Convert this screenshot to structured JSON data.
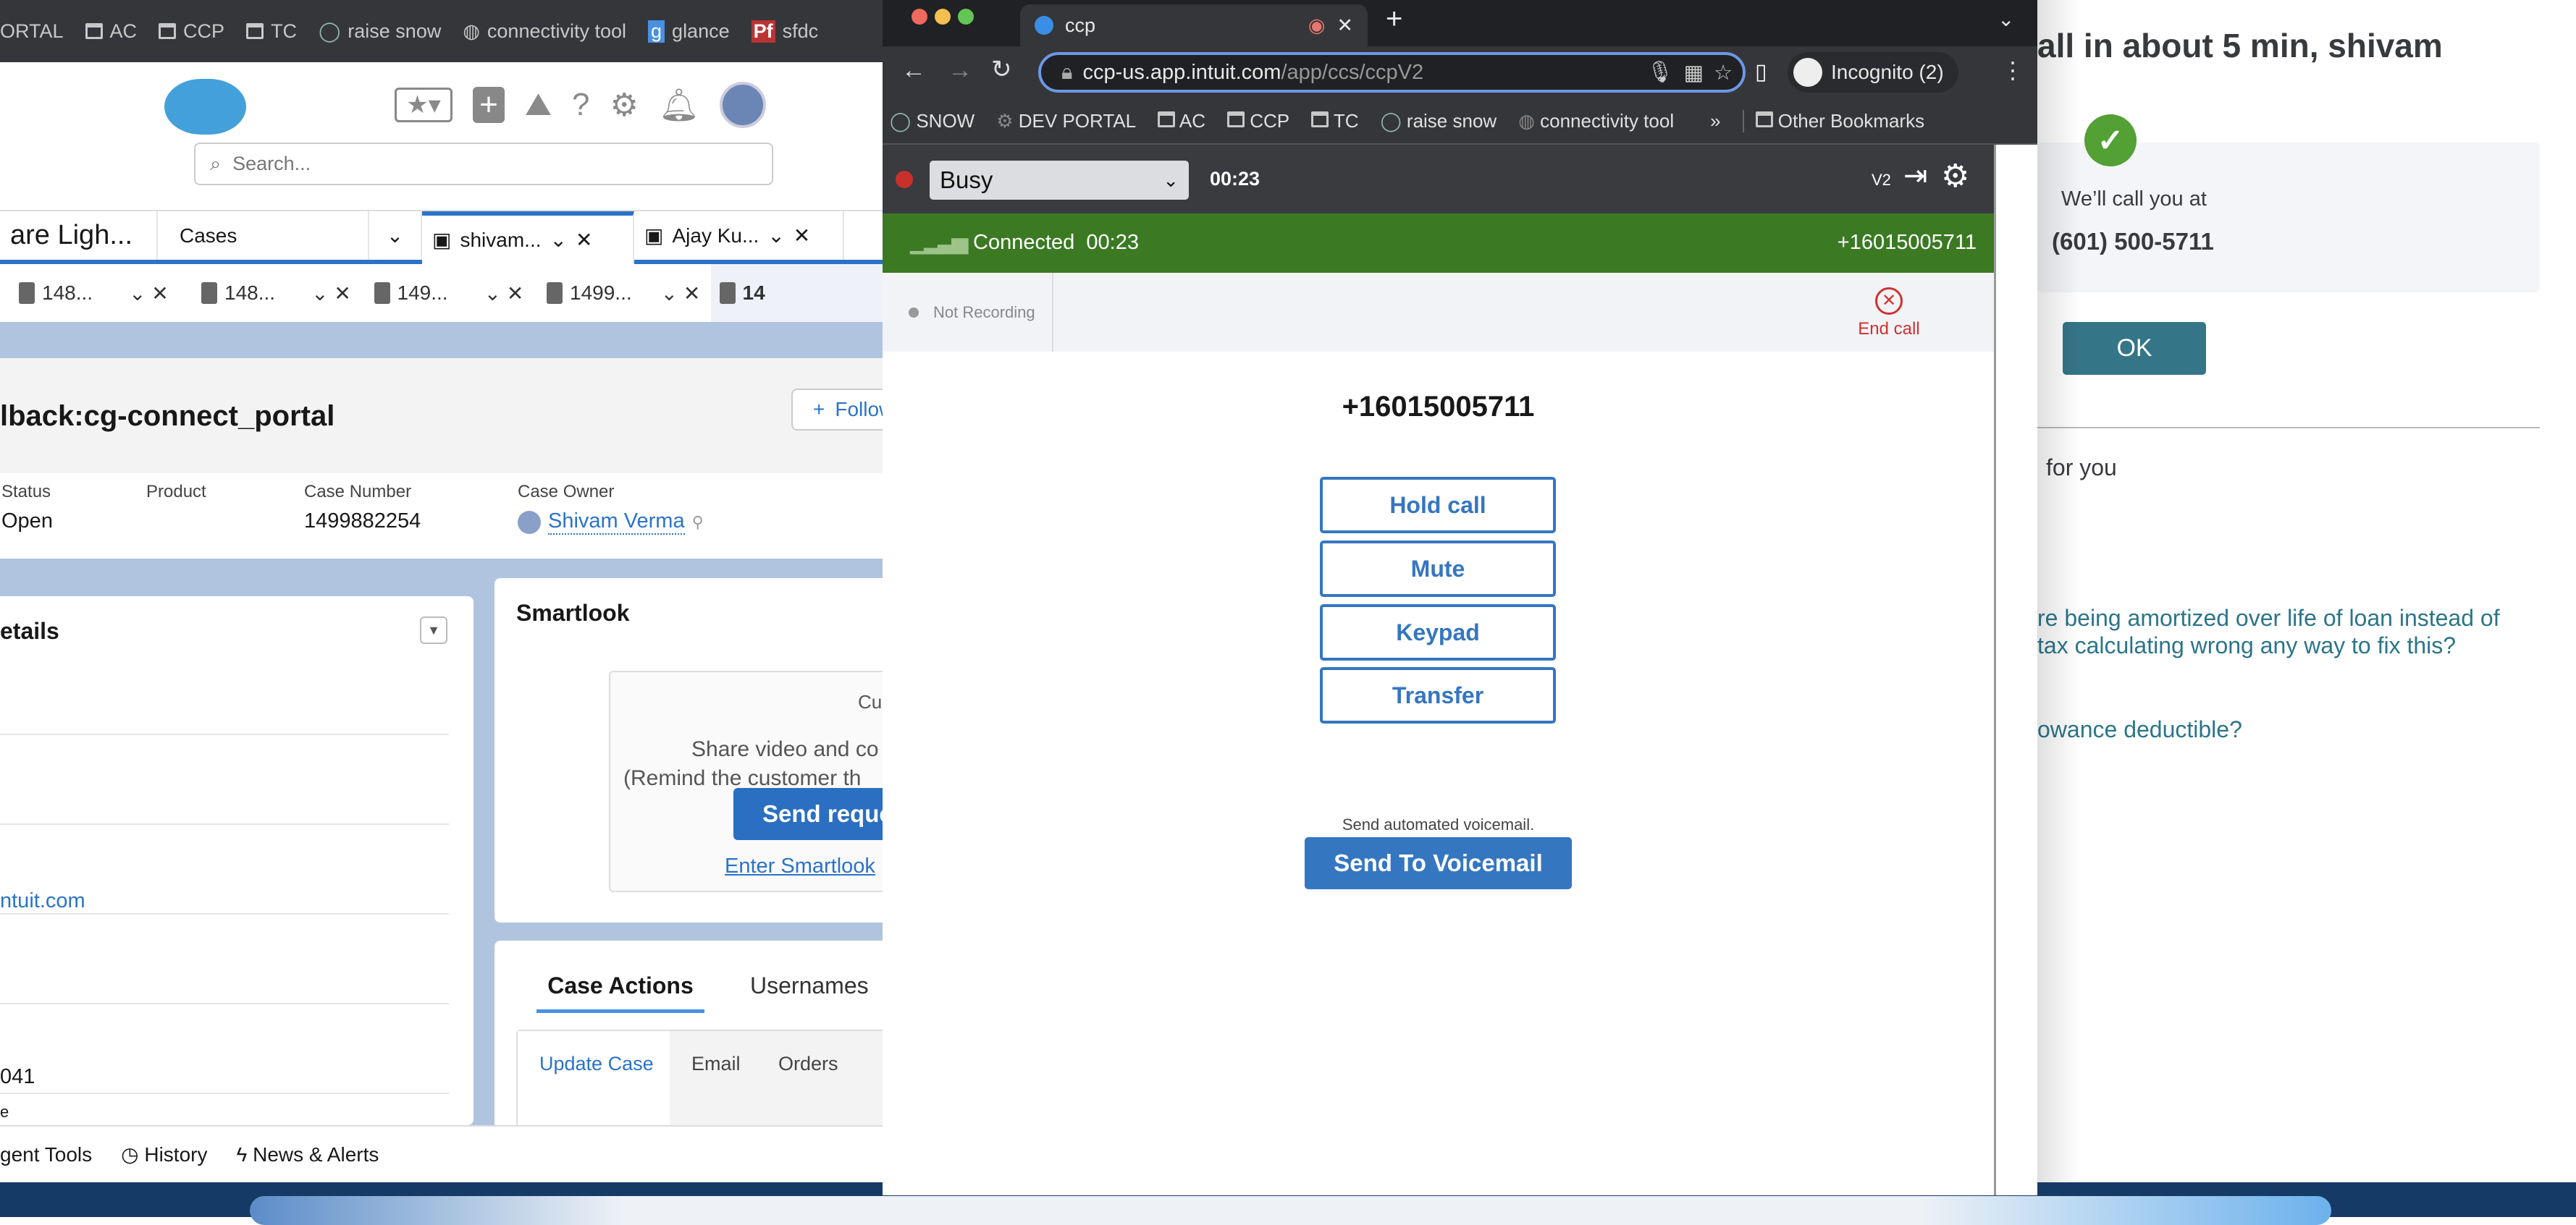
{
  "sf_bookmarks": [
    "ORTAL",
    "AC",
    "CCP",
    "TC",
    "raise snow",
    "connectivity tool",
    "glance",
    "sfdc"
  ],
  "sf_header": {
    "search_placeholder": "Search..."
  },
  "sf_tabs": [
    {
      "label": "are Ligh..."
    },
    {
      "label": "Cases"
    },
    {
      "label": "shivam..."
    },
    {
      "label": "Ajay Ku..."
    }
  ],
  "sf_subtabs": [
    "148...",
    "148...",
    "149...",
    "1499...",
    "14"
  ],
  "case": {
    "title": "lback:cg-connect_portal",
    "follow_label": "Follow",
    "fields": [
      {
        "label": "Status",
        "value": "Open"
      },
      {
        "label": "Product",
        "value": ""
      },
      {
        "label": "Case Number",
        "value": "1499882254"
      },
      {
        "label": "Case Owner",
        "value": "Shivam Verma"
      }
    ]
  },
  "details": {
    "title": "etails",
    "email_fragment": "ntuit.com",
    "number_fragment": "041",
    "trailing_fragment": "e"
  },
  "smartlook": {
    "title": "Smartlook",
    "cu": "Cu",
    "line1": "Share video and co",
    "line2": "(Remind the customer th",
    "send_label": "Send reque",
    "enter_link": "Enter Smartlook"
  },
  "case_actions": {
    "tabs": [
      "Case Actions",
      "Usernames"
    ],
    "subtabs": [
      "Update Case",
      "Email",
      "Orders"
    ]
  },
  "utility_bar": [
    "gent Tools",
    "History",
    "News & Alerts"
  ],
  "ccp_browser": {
    "tab_title": "ccp",
    "url_host": "ccp-us.app.intuit.com",
    "url_path": "/app/ccs/ccpV2",
    "profile": "Incognito (2)",
    "bookmarks": [
      "SNOW",
      "DEV PORTAL",
      "AC",
      "CCP",
      "TC",
      "raise snow",
      "connectivity tool"
    ],
    "more": "»",
    "other_bookmarks": "Other Bookmarks"
  },
  "ccp": {
    "status": "Busy",
    "status_timer": "00:23",
    "version": "V2",
    "connected_label": "Connected",
    "connected_timer": "00:23",
    "caller": "+16015005711",
    "recording": "Not Recording",
    "end_call": "End call",
    "number": "+16015005711",
    "buttons": [
      "Hold call",
      "Mute",
      "Keypad",
      "Transfer"
    ],
    "voicemail_hint": "Send automated voicemail.",
    "voicemail_button": "Send To Voicemail",
    "colors": {
      "connected": "#3b7a23",
      "primary": "#3576c0",
      "end": "#d0312d"
    }
  },
  "callback": {
    "heading": "all in about 5 min, shivam",
    "call_you_at": "We’ll call you at",
    "phone": "(601) 500-5711",
    "ok": "OK",
    "for_you": "for you",
    "link1_line1": "re being amortized over life of loan instead of",
    "link1_line2": "tax calculating wrong any way to fix this?",
    "link2": "owance deductible?"
  }
}
